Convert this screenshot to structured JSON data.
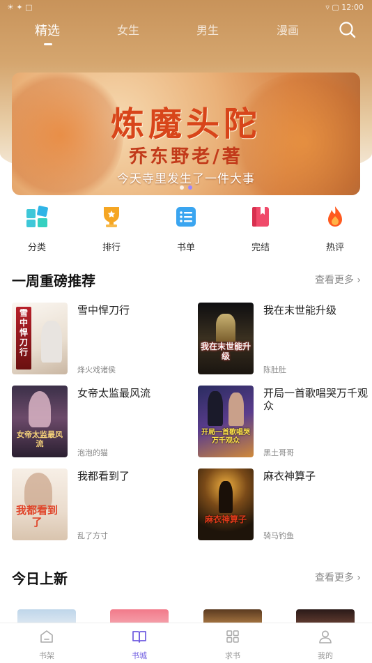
{
  "status_bar": {
    "left": "☀ ✦ □",
    "right": "▿  ▢  12:00"
  },
  "top_tabs": [
    {
      "label": "精选",
      "active": true
    },
    {
      "label": "女生",
      "active": false
    },
    {
      "label": "男生",
      "active": false
    },
    {
      "label": "漫画",
      "active": false
    }
  ],
  "banner": {
    "title": "炼魔头陀",
    "author": "乔东野老/著",
    "tagline": "今天寺里发生了一件大事"
  },
  "quick_links": [
    {
      "label": "分类",
      "icon": "grid-icon",
      "color": "#3ec7d8"
    },
    {
      "label": "排行",
      "icon": "trophy-icon",
      "color": "#f5a623"
    },
    {
      "label": "书单",
      "icon": "list-icon",
      "color": "#3aa5f0"
    },
    {
      "label": "完结",
      "icon": "book-icon",
      "color": "#f04a6a"
    },
    {
      "label": "热评",
      "icon": "flame-icon",
      "color": "#ff6b2b"
    }
  ],
  "weekly": {
    "title": "一周重磅推荐",
    "more": "查看更多 ›",
    "books": [
      {
        "name": "雪中悍刀行",
        "author": "烽火戏诸侯",
        "cover_text": "雪中悍刀行"
      },
      {
        "name": "我在末世能升级",
        "author": "陈肚肚",
        "cover_text": "我在末世能升级"
      },
      {
        "name": "女帝太监最风流",
        "author": "泡泡的猫",
        "cover_text": "女帝太监最风流"
      },
      {
        "name": "开局一首歌唱哭万千观众",
        "author": "黑土哥哥",
        "cover_text": "开局一首歌唱哭万千观众"
      },
      {
        "name": "我都看到了",
        "author": "乱了方寸",
        "cover_text": "我都看到了"
      },
      {
        "name": "麻衣神算子",
        "author": "骑马钓鱼",
        "cover_text": "麻衣神算子"
      }
    ]
  },
  "today": {
    "title": "今日上新",
    "more": "查看更多 ›"
  },
  "bottom_nav": [
    {
      "label": "书架",
      "icon": "shelf-icon",
      "active": false
    },
    {
      "label": "书城",
      "icon": "open-book-icon",
      "active": true
    },
    {
      "label": "求书",
      "icon": "apps-icon",
      "active": false
    },
    {
      "label": "我的",
      "icon": "user-icon",
      "active": false
    }
  ]
}
